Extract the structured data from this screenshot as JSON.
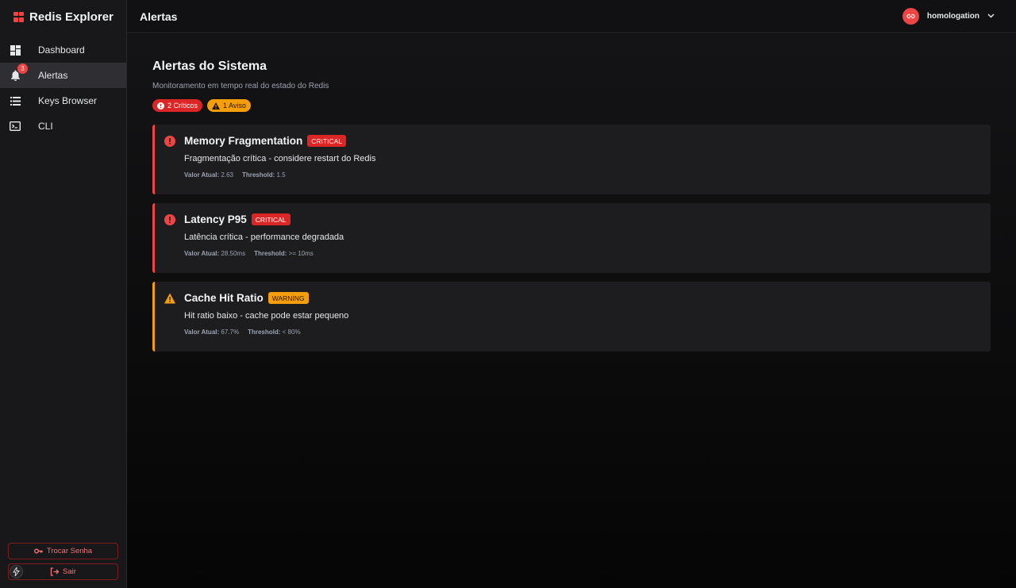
{
  "app": {
    "title": "Redis Explorer"
  },
  "sidebar": {
    "items": [
      {
        "label": "Dashboard",
        "icon": "dashboard-icon"
      },
      {
        "label": "Alertas",
        "icon": "bell-icon",
        "badge": "3"
      },
      {
        "label": "Keys Browser",
        "icon": "list-icon"
      },
      {
        "label": "CLI",
        "icon": "terminal-icon"
      }
    ],
    "change_password_label": "Trocar Senha",
    "logout_label": "Sair"
  },
  "header": {
    "title": "Alertas",
    "environment": "homologation"
  },
  "main": {
    "title": "Alertas do Sistema",
    "subtitle": "Monitoramento em tempo real do estado do Redis",
    "summary": {
      "critical": "2 Críticos",
      "warning": "1 Aviso"
    },
    "current_label": "Valor Atual:",
    "threshold_label": "Threshold:",
    "alerts": [
      {
        "title": "Memory Fragmentation",
        "severity": "CRITICAL",
        "message": "Fragmentação crítica - considere restart do Redis",
        "current": "2.63",
        "threshold": "1.5"
      },
      {
        "title": "Latency P95",
        "severity": "CRITICAL",
        "message": "Latência crítica - performance degradada",
        "current": "28.50ms",
        "threshold": ">= 10ms"
      },
      {
        "title": "Cache Hit Ratio",
        "severity": "WARNING",
        "message": "Hit ratio baixo - cache pode estar pequeno",
        "current": "67.7%",
        "threshold": "< 80%"
      }
    ]
  },
  "colors": {
    "critical": "#ef4444",
    "warning": "#f59e0b",
    "background": "#0b0b0c"
  }
}
